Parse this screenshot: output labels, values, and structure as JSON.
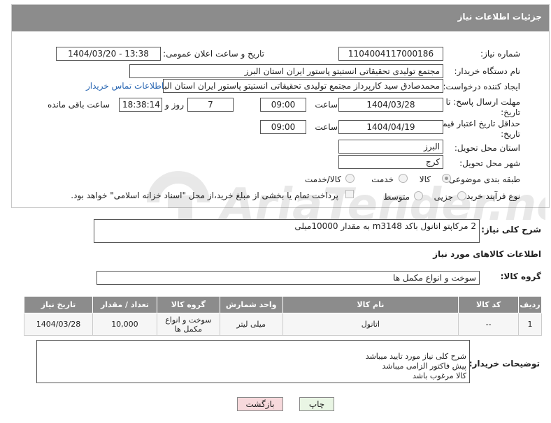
{
  "header": {
    "title": "جزئیات اطلاعات نیاز"
  },
  "form": {
    "need_number_label": "شماره نیاز:",
    "need_number": "1104004117000186",
    "announce_label": "تاریخ و ساعت اعلان عمومی:",
    "announce_value": "1404/03/20 - 13:38",
    "buyer_org_label": "نام دستگاه خریدار:",
    "buyer_org": "مجتمع تولیدی تحقیقاتی انستیتو پاستور ایران استان البرز",
    "creator_label": "ایجاد کننده درخواست:",
    "creator": "محمدصادق سید کارپرداز مجتمع تولیدی تحقیقاتی انستیتو پاستور ایران استان البرز",
    "contact_link": "اطلاعات تماس خریدار",
    "deadline_label": "مهلت ارسال پاسخ: تا تاریخ:",
    "deadline_date": "1404/03/28",
    "time_label": "ساعت",
    "deadline_time": "09:00",
    "days_value": "7",
    "days_label": "روز و",
    "remaining_time": "18:38:14",
    "remaining_label": "ساعت باقی مانده",
    "validity_label": "حداقل تاریخ اعتبار قیمت: تا تاریخ:",
    "validity_date": "1404/04/19",
    "validity_time": "09:00",
    "province_label": "استان محل تحویل:",
    "province": "البرز",
    "city_label": "شهر محل تحویل:",
    "city": "کرج",
    "category_label": "طبقه بندی موضوعی:",
    "category_options": [
      "کالا",
      "خدمت",
      "کالا/خدمت"
    ],
    "process_label": "نوع فرآیند خرید :",
    "process_options": [
      "جزیی",
      "متوسط"
    ],
    "payment_note": "پرداخت تمام یا بخشی از مبلغ خرید،از محل \"اسناد خزانه اسلامی\" خواهد بود."
  },
  "summary": {
    "label": "شرح کلی نیاز:",
    "text": "2 مرکاپتو اتانول باکد m3148 به مقدار 10000میلی"
  },
  "goods_info": {
    "title": "اطلاعات کالاهای مورد نیاز",
    "group_label": "گروه کالا:",
    "group_value": "سوخت و انواع مکمل ها"
  },
  "table": {
    "headers": [
      "ردیف",
      "کد کالا",
      "نام کالا",
      "واحد شمارش",
      "گروه کالا",
      "تعداد / مقدار",
      "تاریخ نیاز"
    ],
    "rows": [
      [
        "1",
        "--",
        "اتانول",
        "میلی لیتر",
        "سوخت و انواع مکمل ها",
        "10,000",
        "1404/03/28"
      ]
    ]
  },
  "buyer_notes": {
    "label": "توضیحات خریدار:",
    "text": "شرح کلی نیاز مورد تایید میباشد\nپیش فاکتور الزامی میباشد\nکالا مرغوب باشد"
  },
  "buttons": {
    "print": "چاپ",
    "back": "بازگشت"
  },
  "colors": {
    "header_bg": "#8c8c8c",
    "link": "#2a67b3",
    "back_btn": "#f7d9dc",
    "print_btn": "#e9f5e4"
  }
}
